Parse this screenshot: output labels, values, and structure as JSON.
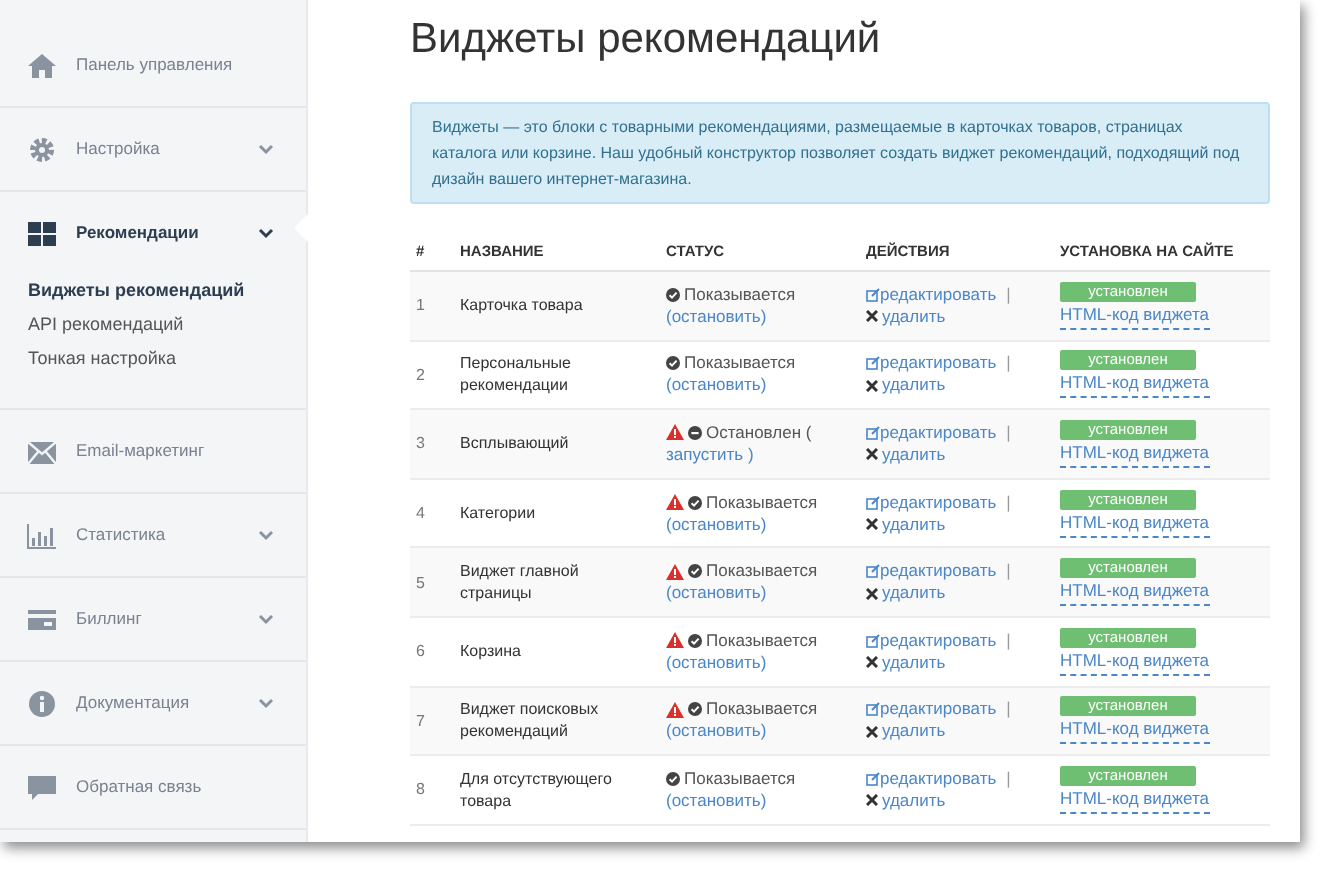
{
  "sidebar": {
    "items": [
      {
        "label": "Панель управления",
        "chevron": false,
        "expanded": false
      },
      {
        "label": "Настройка",
        "chevron": true,
        "expanded": false
      },
      {
        "label": "Рекомендации",
        "chevron": true,
        "expanded": true,
        "children": [
          {
            "label": "Виджеты рекомендаций",
            "selected": true
          },
          {
            "label": "API рекомендаций",
            "selected": false
          },
          {
            "label": "Тонкая настройка",
            "selected": false
          }
        ]
      },
      {
        "label": "Email-маркетинг",
        "chevron": false,
        "expanded": false
      },
      {
        "label": "Статистика",
        "chevron": true,
        "expanded": false
      },
      {
        "label": "Биллинг",
        "chevron": true,
        "expanded": false
      },
      {
        "label": "Документация",
        "chevron": true,
        "expanded": false
      },
      {
        "label": "Обратная связь",
        "chevron": false,
        "expanded": false
      }
    ]
  },
  "title": "Виджеты рекомендаций",
  "info": "Виджеты — это блоки с товарными рекомендациями, размещаемые в карточках товаров, страницах каталога или корзине. Наш удобный конструктор позволяет создать виджет рекомендаций, подходящий под дизайн вашего интернет-магазина.",
  "table": {
    "columns": [
      "#",
      "НАЗВАНИЕ",
      "СТАТУС",
      "ДЕЙСТВИЯ",
      "УСТАНОВКА НА САЙТЕ"
    ],
    "rows": [
      {
        "number": "1",
        "name": "Карточка товара",
        "warning": false,
        "stopped": false,
        "status_text": "Показывается",
        "toggle": "(остановить)",
        "edit": "редактировать",
        "separator": "|",
        "delete": "удалить",
        "badge": "установлен",
        "code_link": "HTML-код виджета"
      },
      {
        "number": "2",
        "name": "Персональные рекомендации",
        "warning": false,
        "stopped": false,
        "status_text": "Показывается",
        "toggle": "(остановить)",
        "edit": "редактировать",
        "separator": "|",
        "delete": "удалить",
        "badge": "установлен",
        "code_link": "HTML-код виджета"
      },
      {
        "number": "3",
        "name": "Всплывающий",
        "warning": true,
        "stopped": true,
        "status_text": "Остановлен (",
        "toggle": "запустить )",
        "edit": "редактировать",
        "separator": "|",
        "delete": "удалить",
        "badge": "установлен",
        "code_link": "HTML-код виджета"
      },
      {
        "number": "4",
        "name": "Категории",
        "warning": true,
        "stopped": false,
        "status_text": "Показывается",
        "toggle": "(остановить)",
        "edit": "редактировать",
        "separator": "|",
        "delete": "удалить",
        "badge": "установлен",
        "code_link": "HTML-код виджета"
      },
      {
        "number": "5",
        "name": "Виджет главной страницы",
        "warning": true,
        "stopped": false,
        "status_text": "Показывается",
        "toggle": "(остановить)",
        "edit": "редактировать",
        "separator": "|",
        "delete": "удалить",
        "badge": "установлен",
        "code_link": "HTML-код виджета"
      },
      {
        "number": "6",
        "name": "Корзина",
        "warning": true,
        "stopped": false,
        "status_text": "Показывается",
        "toggle": "(остановить)",
        "edit": "редактировать",
        "separator": "|",
        "delete": "удалить",
        "badge": "установлен",
        "code_link": "HTML-код виджета"
      },
      {
        "number": "7",
        "name": "Виджет поисковых рекомендаций",
        "warning": true,
        "stopped": false,
        "status_text": "Показывается",
        "toggle": "(остановить)",
        "edit": "редактировать",
        "separator": "|",
        "delete": "удалить",
        "badge": "установлен",
        "code_link": "HTML-код виджета"
      },
      {
        "number": "8",
        "name": "Для отсутствующего товара",
        "warning": false,
        "stopped": false,
        "status_text": "Показывается",
        "toggle": "(остановить)",
        "edit": "редактировать",
        "separator": "|",
        "delete": "удалить",
        "badge": "установлен",
        "code_link": "HTML-код виджета"
      }
    ]
  }
}
